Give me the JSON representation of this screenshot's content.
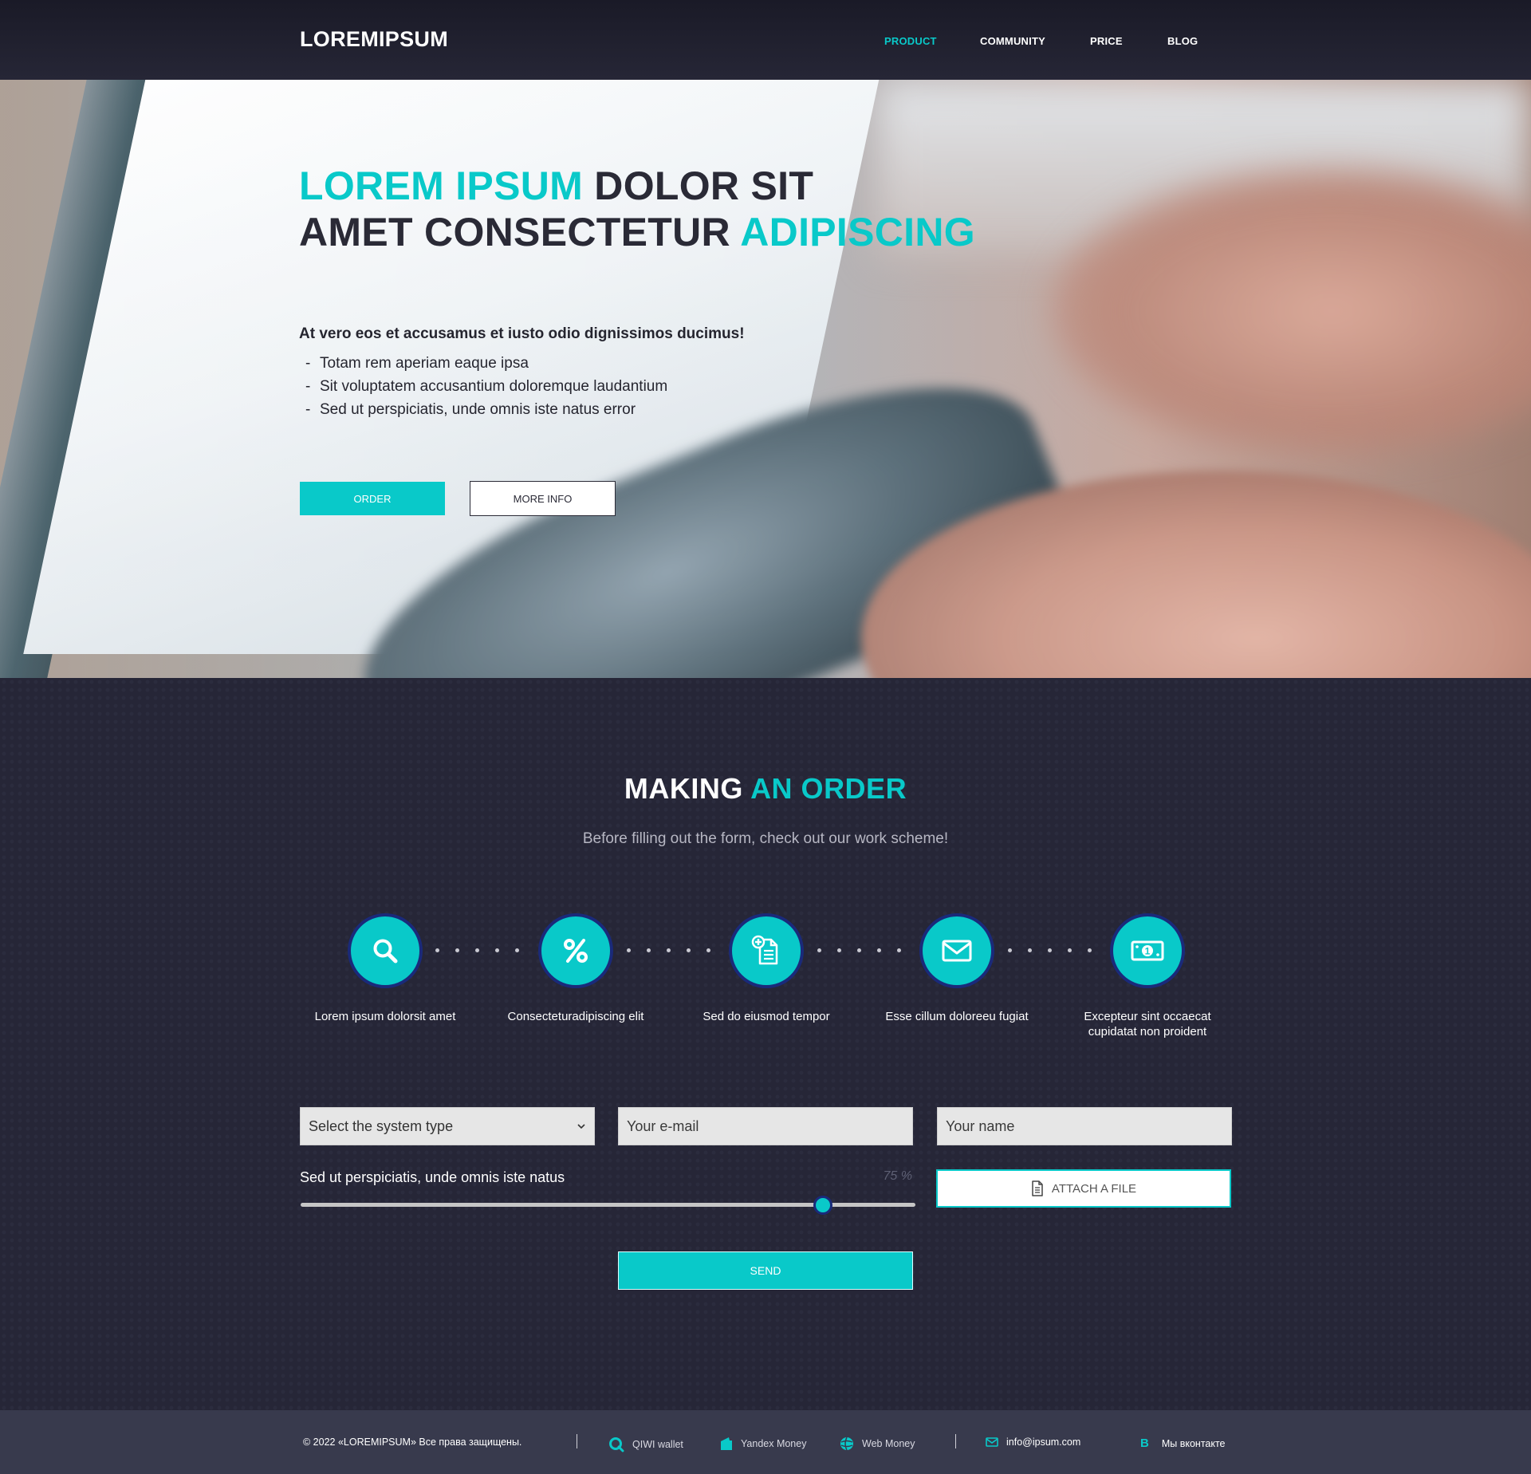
{
  "header": {
    "logo": "LOREMIPSUM",
    "nav": [
      "PRODUCT",
      "COMMUNITY",
      "PRICE",
      "BLOG"
    ],
    "active_nav": "PRODUCT"
  },
  "hero": {
    "title_line1_accent": "LOREM IPSUM",
    "title_line1_rest": " DOLOR SIT",
    "title_line2_rest": "AMET CONSECTETUR ",
    "title_line2_accent": "ADIPISCING",
    "lead": "At vero eos et accusamus et iusto odio dignissimos ducimus!",
    "list": [
      "Totam rem aperiam eaque ipsa",
      "Sit voluptatem accusantium doloremque laudantium",
      "Sed ut perspiciatis, unde omnis iste natus error"
    ],
    "list_marker": "-",
    "order_button": "ORDER",
    "more_button": "MORE INFO"
  },
  "order": {
    "title_plain": "MAKING ",
    "title_accent": "AN ORDER",
    "subtitle": "Before filling out the form, check out our work scheme!",
    "steps": [
      {
        "icon": "search-icon",
        "label": "Lorem ipsum dolorsit amet"
      },
      {
        "icon": "percent-icon",
        "label": "Consecteturadipiscing elit"
      },
      {
        "icon": "document-add-icon",
        "label": "Sed do eiusmod tempor"
      },
      {
        "icon": "envelope-icon",
        "label": "Esse cillum doloreeu fugiat"
      },
      {
        "icon": "banknote-icon",
        "label": "Excepteur sint occaecat cupidatat non proident"
      }
    ],
    "form": {
      "select_value": "Select the system type",
      "email_placeholder": "Your e-mail",
      "name_placeholder": "Your name",
      "slider_label": "Sed ut perspiciatis, unde omnis iste natus",
      "slider_value_text": "75 %",
      "slider_fraction": 0.85,
      "attach_label": "ATTACH A FILE",
      "send_label": "SEND"
    }
  },
  "footer": {
    "copyright": "© 2022 «LOREMIPSUM» Все права защищены.",
    "payments": [
      "QIWI wallet",
      "Yandex Money",
      "Web Money"
    ],
    "email": "info@ipsum.com",
    "vk_letter": "B",
    "vk": "Мы вконтакте"
  },
  "colors": {
    "accent": "#09c9c9",
    "dark_bg": "#262637",
    "footer_bg": "#383a4d",
    "step_border": "#1a2a7a"
  }
}
